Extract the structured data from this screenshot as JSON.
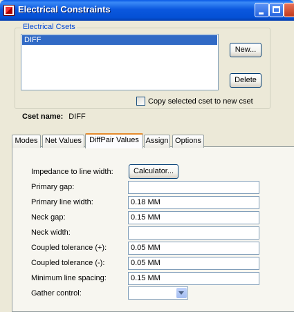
{
  "window": {
    "title": "Electrical Constraints"
  },
  "csets": {
    "group_label": "Electrical Csets",
    "items": [
      "DIFF"
    ],
    "new_label": "New...",
    "delete_label": "Delete",
    "copy_label": "Copy selected cset to new cset",
    "copy_checked": false,
    "name_label": "Cset name:",
    "name_value": "DIFF"
  },
  "tabs": [
    {
      "label": "Modes",
      "active": false
    },
    {
      "label": "Net Values",
      "active": false
    },
    {
      "label": "DiffPair Values",
      "active": true
    },
    {
      "label": "Assign",
      "active": false
    },
    {
      "label": "Options",
      "active": false
    }
  ],
  "form": {
    "impedance_label": "Impedance to line width:",
    "calculator_label": "Calculator...",
    "primary_gap_label": "Primary gap:",
    "primary_gap_value": "",
    "primary_line_width_label": "Primary line width:",
    "primary_line_width_value": "0.18 MM",
    "neck_gap_label": "Neck gap:",
    "neck_gap_value": "0.15 MM",
    "neck_width_label": "Neck width:",
    "neck_width_value": "",
    "coupled_tol_plus_label": "Coupled tolerance (+):",
    "coupled_tol_plus_value": "0.05 MM",
    "coupled_tol_minus_label": "Coupled tolerance (-):",
    "coupled_tol_minus_value": "0.05 MM",
    "min_line_spacing_label": "Minimum line spacing:",
    "min_line_spacing_value": "0.15 MM",
    "gather_control_label": "Gather control:",
    "gather_control_value": ""
  }
}
